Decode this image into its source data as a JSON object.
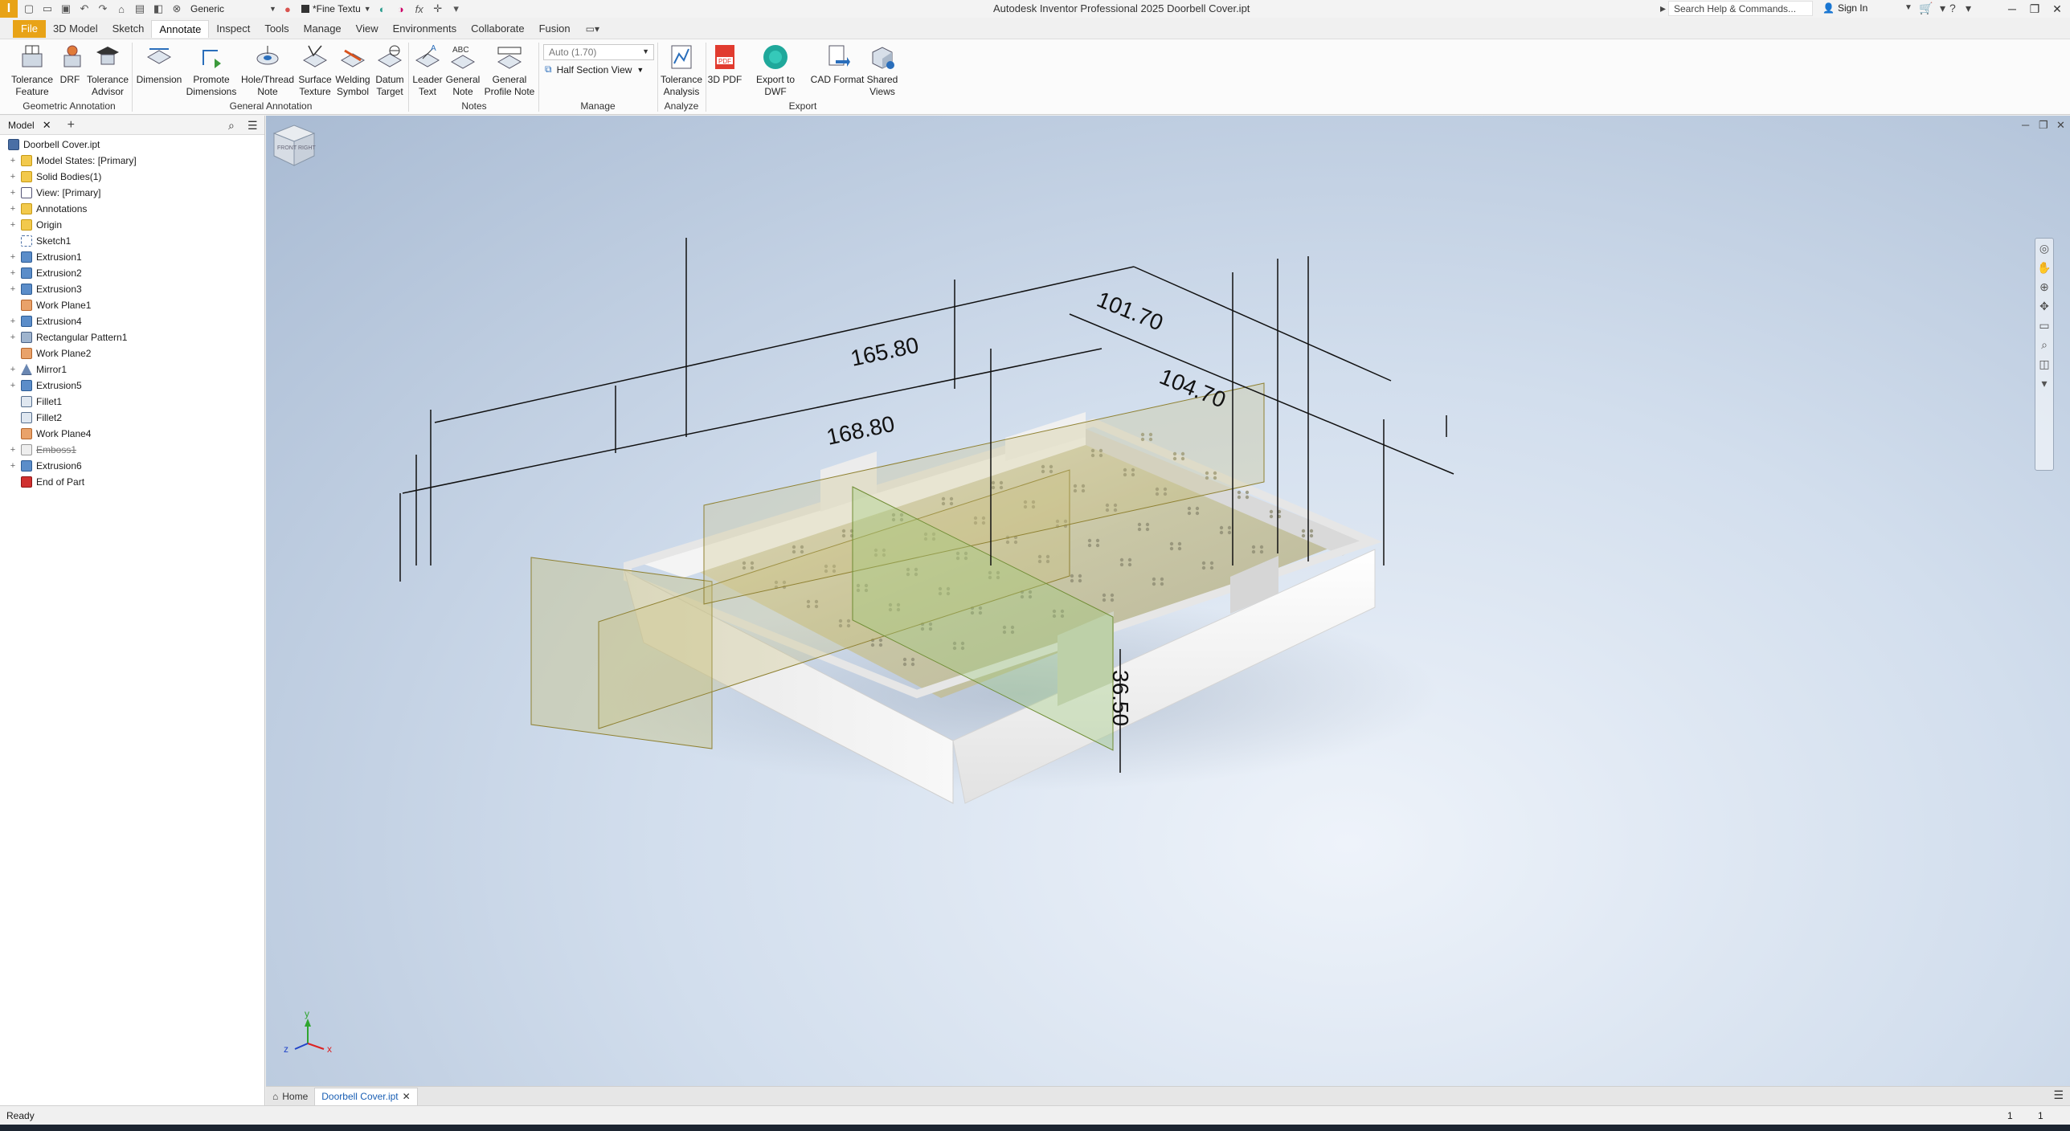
{
  "titlebar": {
    "logo": "I",
    "appearance_combo": "Generic",
    "material_combo": "*Fine Textu",
    "fx_label": "fx",
    "app_title": "Autodesk Inventor Professional 2025   Doorbell Cover.ipt",
    "search_placeholder": "Search Help & Commands...",
    "signin_label": "Sign In"
  },
  "ribbon_tabs": [
    "File",
    "3D Model",
    "Sketch",
    "Annotate",
    "Inspect",
    "Tools",
    "Manage",
    "View",
    "Environments",
    "Collaborate",
    "Fusion"
  ],
  "ribbon": {
    "buttons": [
      {
        "line1": "Tolerance",
        "line2": "Feature"
      },
      {
        "line1": "DRF",
        "line2": ""
      },
      {
        "line1": "Tolerance",
        "line2": "Advisor"
      },
      {
        "line1": "Dimension",
        "line2": ""
      },
      {
        "line1": "Promote",
        "line2": "Dimensions"
      },
      {
        "line1": "Hole/Thread",
        "line2": "Note"
      },
      {
        "line1": "Surface",
        "line2": "Texture"
      },
      {
        "line1": "Welding",
        "line2": "Symbol"
      },
      {
        "line1": "Datum",
        "line2": "Target"
      },
      {
        "line1": "Leader",
        "line2": "Text"
      },
      {
        "line1": "General",
        "line2": "Note"
      },
      {
        "line1": "General",
        "line2": "Profile Note"
      },
      {
        "line1": "Tolerance",
        "line2": "Analysis"
      },
      {
        "line1": "3D PDF",
        "line2": ""
      },
      {
        "line1": "Export to DWF",
        "line2": ""
      },
      {
        "line1": "CAD Format",
        "line2": ""
      },
      {
        "line1": "Shared",
        "line2": "Views"
      }
    ],
    "style_combo": "Auto (1.70)",
    "half_section": "Half Section View",
    "panels": [
      "Geometric Annotation",
      "General Annotation",
      "Notes",
      "Manage",
      "Analyze",
      "Export"
    ]
  },
  "browser": {
    "tab_label": "Model",
    "root": "Doorbell Cover.ipt",
    "nodes": [
      {
        "label": "Model States: [Primary]",
        "icon": "folder",
        "exp": "+"
      },
      {
        "label": "Solid Bodies(1)",
        "icon": "folder",
        "exp": "+"
      },
      {
        "label": "View: [Primary]",
        "icon": "view",
        "exp": "+"
      },
      {
        "label": "Annotations",
        "icon": "folder",
        "exp": "+"
      },
      {
        "label": "Origin",
        "icon": "folder",
        "exp": "+"
      },
      {
        "label": "Sketch1",
        "icon": "sketch",
        "exp": ""
      },
      {
        "label": "Extrusion1",
        "icon": "extr",
        "exp": "+"
      },
      {
        "label": "Extrusion2",
        "icon": "extr",
        "exp": "+"
      },
      {
        "label": "Extrusion3",
        "icon": "extr",
        "exp": "+"
      },
      {
        "label": "Work Plane1",
        "icon": "plane",
        "exp": ""
      },
      {
        "label": "Extrusion4",
        "icon": "extr",
        "exp": "+"
      },
      {
        "label": "Rectangular Pattern1",
        "icon": "pattern",
        "exp": "+"
      },
      {
        "label": "Work Plane2",
        "icon": "plane",
        "exp": ""
      },
      {
        "label": "Mirror1",
        "icon": "mirror",
        "exp": "+"
      },
      {
        "label": "Extrusion5",
        "icon": "extr",
        "exp": "+"
      },
      {
        "label": "Fillet1",
        "icon": "fillet",
        "exp": ""
      },
      {
        "label": "Fillet2",
        "icon": "fillet",
        "exp": ""
      },
      {
        "label": "Work Plane4",
        "icon": "plane",
        "exp": ""
      },
      {
        "label": "Emboss1",
        "icon": "emboss",
        "exp": "+",
        "suppressed": true
      },
      {
        "label": "Extrusion6",
        "icon": "extr",
        "exp": "+"
      },
      {
        "label": "End of Part",
        "icon": "end",
        "exp": ""
      }
    ]
  },
  "viewport": {
    "dimensions": [
      "165.80",
      "168.80",
      "101.70",
      "104.70",
      "36.50"
    ],
    "viewcube_front": "FRONT",
    "viewcube_right": "RIGHT",
    "axis_x": "x",
    "axis_y": "y",
    "axis_z": "z"
  },
  "doc_tabs": {
    "home": "Home",
    "active": "Doorbell Cover.ipt"
  },
  "status": {
    "text": "Ready",
    "n1": "1",
    "n2": "1"
  }
}
